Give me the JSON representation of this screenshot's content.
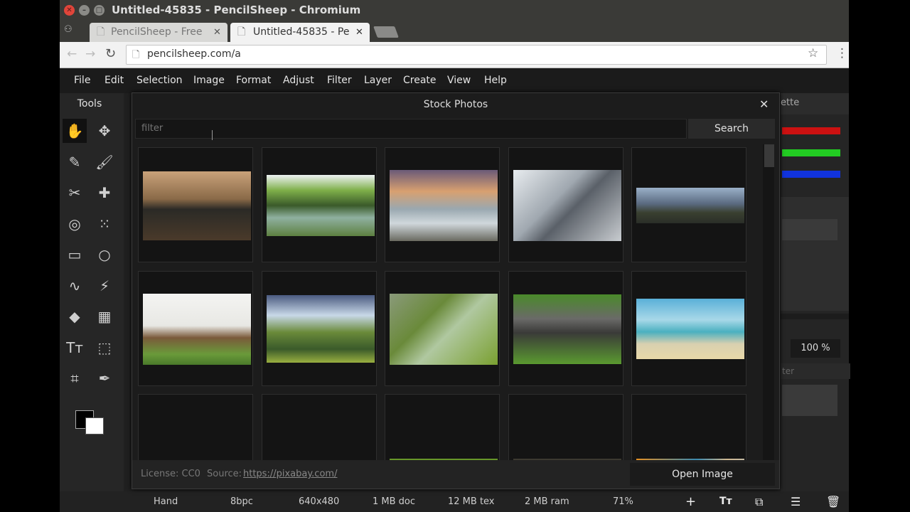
{
  "browser": {
    "window_title": "Untitled-45835 - PencilSheep - Chromium",
    "tabs": [
      {
        "label": "PencilSheep - Free"
      },
      {
        "label": "Untitled-45835 - Pe"
      }
    ],
    "url": "pencilsheep.com/a"
  },
  "menu": [
    "File",
    "Edit",
    "Selection",
    "Image",
    "Format",
    "Adjust",
    "Filter",
    "Layer",
    "Create",
    "View",
    "Help"
  ],
  "tools_panel": {
    "title": "Tools",
    "tools": [
      {
        "name": "hand-tool",
        "glyph": "✋"
      },
      {
        "name": "move-tool",
        "glyph": "✥"
      },
      {
        "name": "pencil-tool",
        "glyph": "✎"
      },
      {
        "name": "brush-tool",
        "glyph": "🖌"
      },
      {
        "name": "scissors-tool",
        "glyph": "✂"
      },
      {
        "name": "heal-tool",
        "glyph": "✚"
      },
      {
        "name": "smudge-tool",
        "glyph": "◎"
      },
      {
        "name": "pattern-tool",
        "glyph": "⁙"
      },
      {
        "name": "rectangle-tool",
        "glyph": "▭"
      },
      {
        "name": "ellipse-tool",
        "glyph": "○"
      },
      {
        "name": "lasso-tool",
        "glyph": "∿"
      },
      {
        "name": "magic-wand-tool",
        "glyph": "⚡"
      },
      {
        "name": "fill-tool",
        "glyph": "◆"
      },
      {
        "name": "gradient-tool",
        "glyph": "▦"
      },
      {
        "name": "text-tool",
        "glyph": "Tт"
      },
      {
        "name": "transform-tool",
        "glyph": "⬚"
      },
      {
        "name": "crop-tool",
        "glyph": "⌗"
      },
      {
        "name": "eyedropper-tool",
        "glyph": "✒"
      }
    ],
    "foreground_color": "#000000",
    "background_color": "#ffffff"
  },
  "right_panel": {
    "title_fragment": "ette",
    "zoom_value": "100 %",
    "filter_fragment": "ter",
    "channel_colors": [
      "#cc1111",
      "#22cc22",
      "#1133dd"
    ]
  },
  "dialog": {
    "title": "Stock Photos",
    "filter_placeholder": "filter",
    "search_label": "Search",
    "license_text": "License: CC0",
    "source_label": "Source:",
    "source_link": "https://pixabay.com/",
    "open_label": "Open Image",
    "photos": [
      {
        "name": "helmet-photo",
        "bg": "linear-gradient(180deg,#c9a27a 0%,#8a6a48 40%,#2b2a26 55%,#4a3a2a 100%)",
        "h": 97
      },
      {
        "name": "lake-reflection-photo",
        "bg": "linear-gradient(180deg,#eef2f4 0%,#7fb04a 25%,#3a5a2a 50%,#8fb0a0 70%,#5d8040 100%)",
        "h": 86
      },
      {
        "name": "waterfall-seascape-photo",
        "bg": "linear-gradient(180deg,#6a5a78 0%,#d8a070 30%,#9aa8b0 55%,#d0d8dc 75%,#6a6a60 100%)",
        "h": 100
      },
      {
        "name": "glasses-on-newspaper-photo",
        "bg": "linear-gradient(135deg,#e8ecef 0%,#a0a8b0 40%,#5a6068 55%,#c8ccd0 100%)",
        "h": 100
      },
      {
        "name": "mountain-clouds-photo",
        "bg": "linear-gradient(180deg,#9ab0c8 0%,#5a6a80 45%,#3a4030 70%,#2a2e28 100%)",
        "h": 50
      },
      {
        "name": "bears-photo",
        "bg": "linear-gradient(180deg,#f4f4f2 0%,#e8e8e4 45%,#7a5a3a 62%,#6a9a3a 85%,#4a7a2a 100%)",
        "h": 100
      },
      {
        "name": "green-hills-photo",
        "bg": "linear-gradient(180deg,#4a5a80 0%,#c8d8e8 30%,#6a8a3a 55%,#3a5a2a 80%,#9ab040 100%)",
        "h": 95
      },
      {
        "name": "buckle-leaf-photo",
        "bg": "linear-gradient(135deg,#8a9a7a 0%,#6a8a3a 35%,#b0c8a0 55%,#7aa030 100%)",
        "h": 100
      },
      {
        "name": "clasp-on-grass-photo",
        "bg": "linear-gradient(180deg,#4a8a2a 0%,#6a6a68 35%,#3a3a38 55%,#5a9a30 100%)",
        "h": 98
      },
      {
        "name": "beach-sea-photo",
        "bg": "linear-gradient(180deg,#5ab0d8 0%,#a8d8e8 35%,#4ab0c0 55%,#d8d0b0 75%,#e8d8a8 100%)",
        "h": 85
      },
      {
        "name": "food-table-photo",
        "bg": "linear-gradient(180deg,#d0c8a8 0%,#c03050 45%,#f0f0f0 65%,#a07030 100%)",
        "h": 55
      },
      {
        "name": "snowy-mountain-lake-photo",
        "bg": "linear-gradient(180deg,#c8d0d8 0%,#808890 45%,#3a4048 70%,#5a6870 100%)",
        "h": 45
      },
      {
        "name": "apples-photo",
        "bg": "linear-gradient(180deg,#6a9a2a 0%,#3a6a1a 40%,#b03a1a 60%,#5a8a2a 100%)",
        "h": 62
      },
      {
        "name": "lion-photo",
        "bg": "linear-gradient(180deg,#3a3830 0%,#6a5a40 45%,#8a7050 70%,#2a2820 100%)",
        "h": 62
      },
      {
        "name": "teddy-bears-photo",
        "bg": "linear-gradient(135deg,#e89020 0%,#3a8ab0 40%,#d0b890 60%,#a8c0d0 100%)",
        "h": 62
      }
    ]
  },
  "status": {
    "tool": "Hand",
    "depth": "8bpc",
    "size": "640x480",
    "doc": "1 MB doc",
    "tex": "12 MB tex",
    "ram": "2 MB ram",
    "zoom": "71%"
  }
}
